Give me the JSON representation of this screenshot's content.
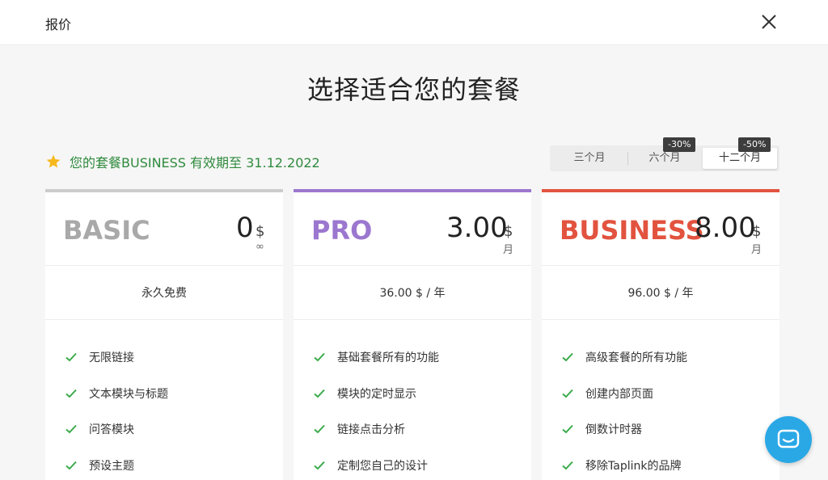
{
  "header": {
    "title": "报价"
  },
  "main": {
    "title": "选择适合您的套餐"
  },
  "status": {
    "text": "您的套餐BUSINESS 有效期至 31.12.2022"
  },
  "period": {
    "options": [
      {
        "label": "三个月",
        "badge": ""
      },
      {
        "label": "六个月",
        "badge": "-30%"
      },
      {
        "label": "十二个月",
        "badge": "-50%"
      }
    ],
    "selected": "十二个月"
  },
  "colors": {
    "basic": "#a9a9a9",
    "pro": "#9b77cf",
    "business": "#e2533f",
    "check": "#3aaa4a",
    "chat": "#2aa8e6"
  },
  "plans": [
    {
      "name": "BASIC",
      "price": "0",
      "currency": "$",
      "unit": "∞",
      "subtitle": "永久免费",
      "features": [
        "无限链接",
        "文本模块与标题",
        "问答模块",
        "预设主题"
      ]
    },
    {
      "name": "PRO",
      "price": "3.00",
      "currency": "$",
      "unit": "月",
      "subtitle": "36.00 $ / 年",
      "features": [
        "基础套餐所有的功能",
        "模块的定时显示",
        "链接点击分析",
        "定制您自己的设计"
      ]
    },
    {
      "name": "BUSINESS",
      "price": "8.00",
      "currency": "$",
      "unit": "月",
      "subtitle": "96.00 $ / 年",
      "features": [
        "高级套餐的所有功能",
        "创建内部页面",
        "倒数计时器",
        "移除Taplink的品牌"
      ]
    }
  ]
}
